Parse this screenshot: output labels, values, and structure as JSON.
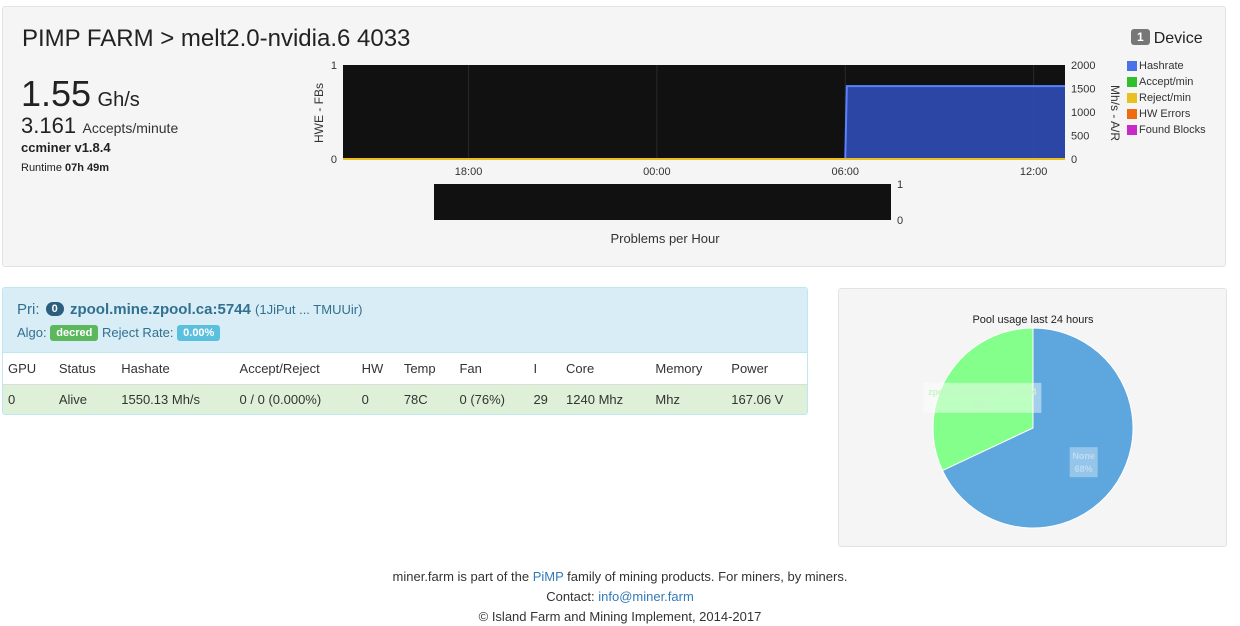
{
  "header": {
    "title": "PIMP FARM > melt2.0-nvidia.6 4033",
    "hashrate_value": "1.55",
    "hashrate_unit": "Gh/s",
    "accepts_value": "3.161",
    "accepts_unit": "Accepts/minute",
    "miner_version": "ccminer v1.8.4",
    "runtime_label": "Runtime",
    "runtime_value": "07h 49m"
  },
  "device": {
    "count": "1",
    "label": "Device"
  },
  "legend": [
    {
      "name": "Hashrate",
      "color": "#4a72e8"
    },
    {
      "name": "Accept/min",
      "color": "#2fbf2f"
    },
    {
      "name": "Reject/min",
      "color": "#e8c020"
    },
    {
      "name": "HW Errors",
      "color": "#f06a10"
    },
    {
      "name": "Found Blocks",
      "color": "#c82ac8"
    }
  ],
  "chart_data": [
    {
      "type": "area",
      "title": "",
      "ylabel_left": "HWE - FBs",
      "ylabel_right": "Mh/s - A/R",
      "x_ticks": [
        "18:00",
        "00:00",
        "06:00",
        "12:00"
      ],
      "y_left_ticks": [
        "0",
        "1"
      ],
      "y_right_ticks": [
        "0",
        "500",
        "1000",
        "1500",
        "2000"
      ],
      "ylim_left": [
        0,
        1
      ],
      "ylim_right": [
        0,
        2000
      ],
      "xlim_hours": [
        14.0,
        37.0
      ],
      "grid": true,
      "series": [
        {
          "name": "Hashrate",
          "color": "#4a72e8",
          "axis": "right",
          "points": [
            [
              14.0,
              0
            ],
            [
              30.0,
              0
            ],
            [
              30.05,
              1550
            ],
            [
              37.0,
              1550
            ]
          ]
        },
        {
          "name": "Reject/min",
          "color": "#e8c020",
          "axis": "right",
          "points": [
            [
              14.0,
              0
            ],
            [
              37.0,
              0
            ]
          ]
        }
      ]
    },
    {
      "type": "bar",
      "title": "",
      "xlabel": "Problems per Hour",
      "y_ticks": [
        "0",
        "1"
      ],
      "ylim": [
        0,
        1
      ],
      "values": []
    },
    {
      "type": "pie",
      "title": "Pool usage last 24 hours",
      "slices": [
        {
          "label": "zpool.mine.zpool.ca:5744",
          "percent_label": "32%",
          "value": 32,
          "color": "#85ff8c"
        },
        {
          "label": "None",
          "percent_label": "68%",
          "value": 68,
          "color": "#5da6de"
        }
      ]
    }
  ],
  "pool": {
    "prefix": "Pri:",
    "badge": "0",
    "url": "zpool.mine.zpool.ca:5744",
    "wallet": "(1JiPut ... TMUUir)",
    "algo_label": "Algo:",
    "algo_value": "decred",
    "reject_label": "Reject Rate:",
    "reject_value": "0.00%"
  },
  "gpu_table": {
    "columns": [
      "GPU",
      "Status",
      "Hashate",
      "Accept/Reject",
      "HW",
      "Temp",
      "Fan",
      "I",
      "Core",
      "Memory",
      "Power"
    ],
    "rows": [
      [
        "0",
        "Alive",
        "1550.13 Mh/s",
        "0 / 0 (0.000%)",
        "0",
        "78C",
        "0 (76%)",
        "29",
        "1240 Mhz",
        "Mhz",
        "167.06 V"
      ]
    ]
  },
  "footer": {
    "line1_pre": "miner.farm is part of the ",
    "line1_link": "PiMP",
    "line1_post": " family of mining products. For miners, by miners.",
    "contact_label": "Contact: ",
    "contact_email": "info@miner.farm",
    "copyright": "© Island Farm and Mining Implement, 2014-2017"
  }
}
